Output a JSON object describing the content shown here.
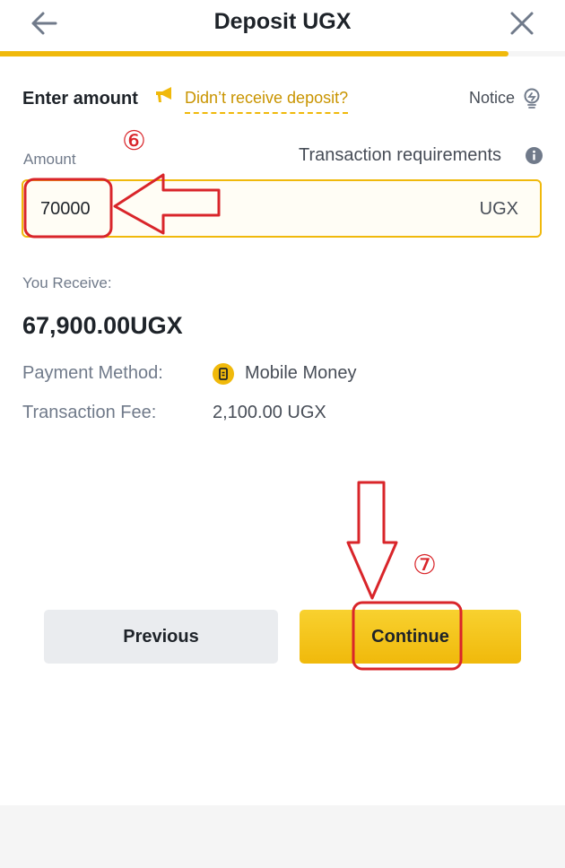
{
  "header": {
    "title": "Deposit UGX",
    "back_icon": "arrow-left-icon",
    "close_icon": "close-icon",
    "progress_fraction": 0.9,
    "accent_color": "#f0b90b"
  },
  "enter_amount": {
    "label": "Enter amount",
    "megaphone_icon": "megaphone-icon",
    "didnt_receive_link": "Didn’t receive deposit?",
    "notice_label": "Notice",
    "notice_icon": "lightbulb-icon"
  },
  "amount": {
    "label": "Amount",
    "requirements_label": "Transaction requirements",
    "requirements_icon": "info-icon",
    "value": "70000",
    "currency": "UGX"
  },
  "summary": {
    "receive_label": "You Receive:",
    "receive_value": "67,900.00UGX",
    "payment_method_label": "Payment Method:",
    "payment_method_icon": "mobile-money-icon",
    "payment_method_value": "Mobile Money",
    "fee_label": "Transaction Fee:",
    "fee_value": "2,100.00 UGX"
  },
  "buttons": {
    "previous": "Previous",
    "continue": "Continue"
  },
  "annotations": {
    "step_6": "⑥",
    "step_7": "⑦",
    "color": "#d9252a"
  }
}
